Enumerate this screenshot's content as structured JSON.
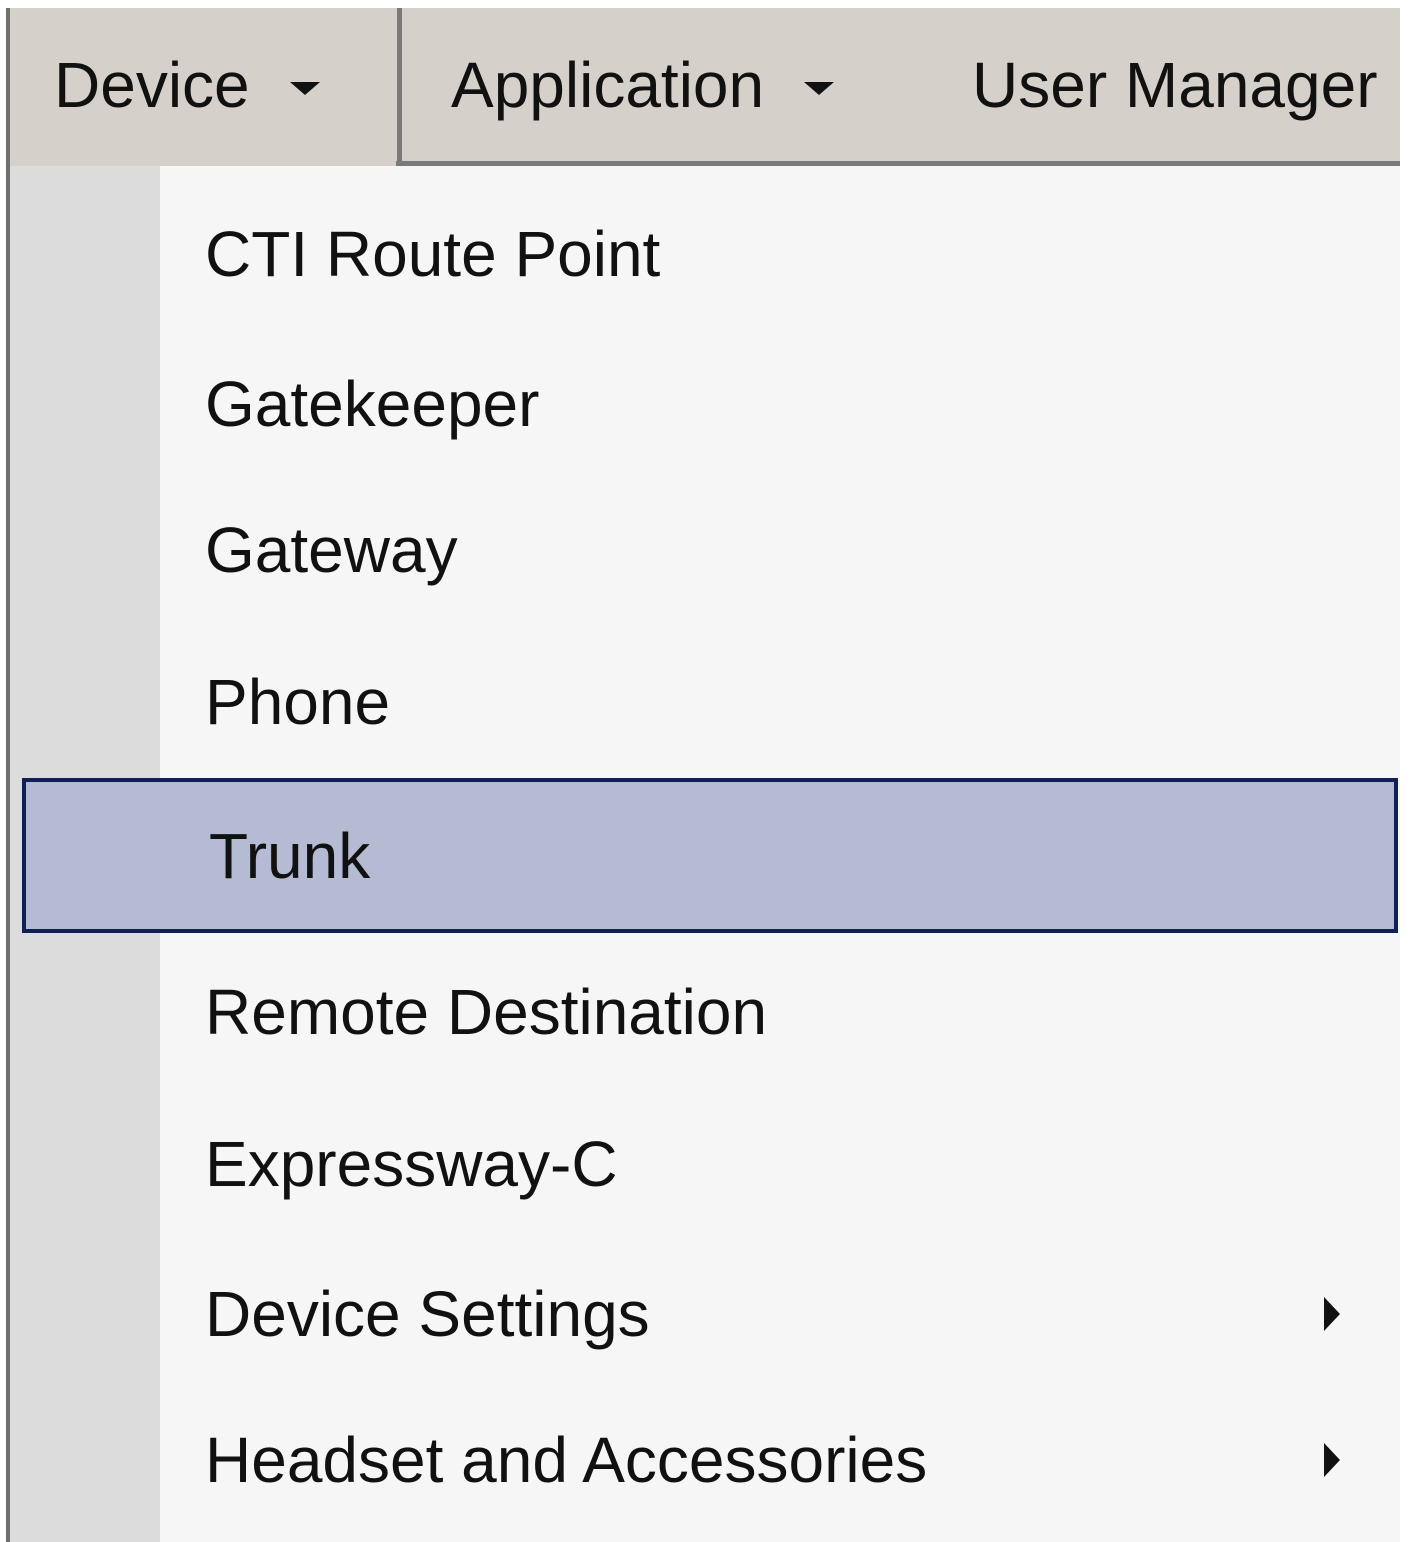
{
  "menubar": {
    "items": [
      {
        "label": "Device",
        "has_dropdown": true,
        "active": true
      },
      {
        "label": "Application",
        "has_dropdown": true,
        "active": false
      },
      {
        "label": "User Manager",
        "has_dropdown": false,
        "active": false
      }
    ]
  },
  "dropdown": {
    "items": [
      {
        "label": "CTI Route Point",
        "selected": false,
        "submenu": false
      },
      {
        "label": "Gatekeeper",
        "selected": false,
        "submenu": false
      },
      {
        "label": "Gateway",
        "selected": false,
        "submenu": false
      },
      {
        "label": "Phone",
        "selected": false,
        "submenu": false
      },
      {
        "label": "Trunk",
        "selected": true,
        "submenu": false
      },
      {
        "label": "Remote Destination",
        "selected": false,
        "submenu": false
      },
      {
        "label": "Expressway-C",
        "selected": false,
        "submenu": false
      },
      {
        "label": "Device Settings",
        "selected": false,
        "submenu": true
      },
      {
        "label": "Headset and Accessories",
        "selected": false,
        "submenu": true
      }
    ]
  },
  "icons": {
    "menu_dropdown": "caret-down-icon",
    "submenu": "caret-right-icon"
  },
  "colors": {
    "menubar_bg": "#d5d1ca",
    "dropdown_bg": "#f6f6f6",
    "gutter_bg": "#dcdcdc",
    "selected_bg": "#b5bbd2",
    "selected_border": "#0e2057"
  }
}
